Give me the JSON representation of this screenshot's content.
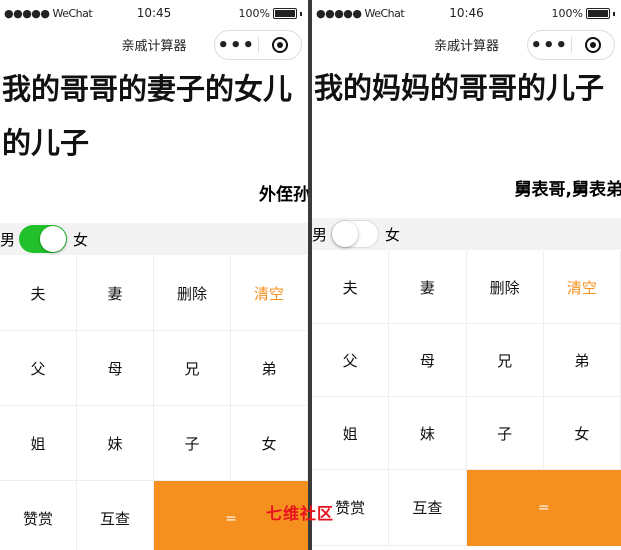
{
  "app_title": "亲戚计算器",
  "phones": [
    {
      "status": {
        "carrier": "●●●●● WeChat",
        "time": "10:45",
        "battery": "100%"
      },
      "query_line1": "我的哥哥的妻子的女儿",
      "query_line2": "的儿子",
      "result": "外侄孙",
      "gender_male": "男",
      "gender_female": "女",
      "toggle_state": "on"
    },
    {
      "status": {
        "carrier": "●●●●● WeChat",
        "time": "10:46",
        "battery": "100%"
      },
      "query_line1": "我的妈妈的哥哥的儿子",
      "query_line2": "",
      "result": "舅表哥,舅表弟",
      "gender_male": "男",
      "gender_female": "女",
      "toggle_state": "off"
    }
  ],
  "keypad": {
    "husband": "夫",
    "wife": "妻",
    "delete": "删除",
    "clear": "清空",
    "father": "父",
    "mother": "母",
    "elder_brother": "兄",
    "younger_brother": "弟",
    "elder_sister": "姐",
    "younger_sister": "妹",
    "son": "子",
    "daughter": "女",
    "reward": "赞赏",
    "reverse": "互查",
    "equals": "="
  },
  "watermark": "七维社区",
  "colors": {
    "accent": "#f5901e",
    "toggle_on": "#22c12c",
    "bar": "#f3f3f3"
  }
}
